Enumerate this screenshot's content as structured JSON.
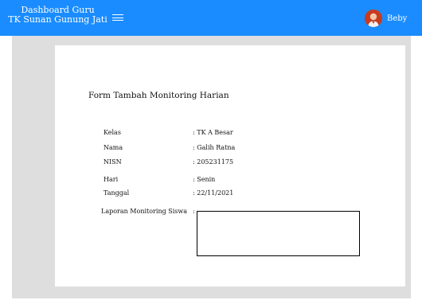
{
  "navbar": {
    "brand_line1": "Dashboard Guru",
    "brand_line2": "TK Sunan Gunung Jati",
    "menu_icon": "hamburger-menu-icon",
    "user_name": "Beby",
    "color": "#1a8cff"
  },
  "form": {
    "title": "Form Tambah Monitoring Harian",
    "rows": [
      {
        "label": "Kelas",
        "value": ": TK A Besar"
      },
      {
        "label": "Nama",
        "value": ": Galih Ratna"
      },
      {
        "label": "NISN",
        "value": ": 205231175"
      },
      {
        "label": "Hari",
        "value": ": Senin"
      },
      {
        "label": "Tanggal",
        "value": ": 22/11/2021"
      }
    ],
    "report_label": "Laporan Monitoring Siswa",
    "report_colon": ":",
    "report_value": ""
  }
}
